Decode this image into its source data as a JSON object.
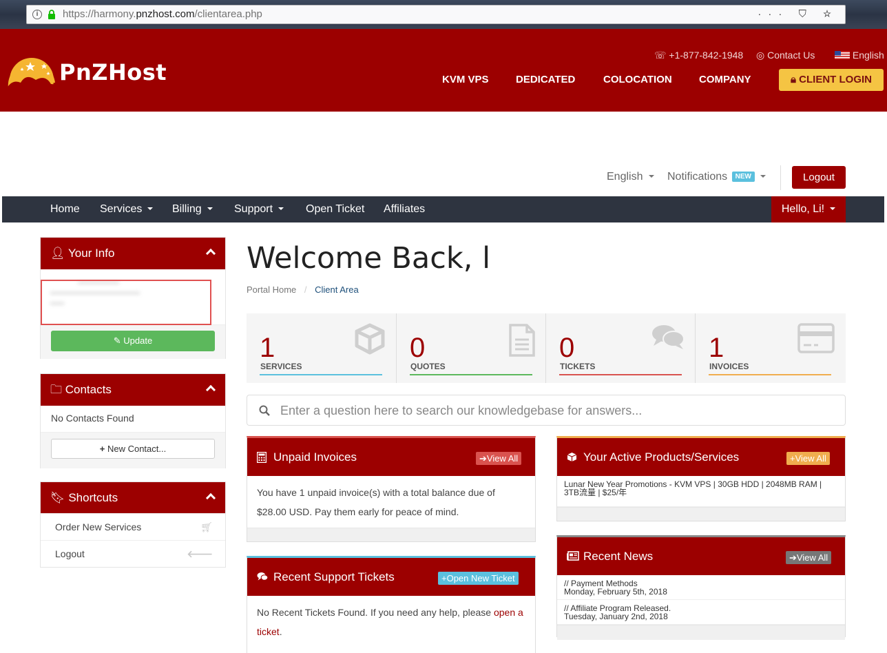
{
  "browser": {
    "url_prefix": "https://harmony.",
    "url_domain": "pnzhost.com",
    "url_path": "/clientarea.php",
    "tools": "··· ⛉ ☆"
  },
  "header": {
    "logo": "PnZHost",
    "phone": "+1-877-842-1948",
    "contact": "Contact Us",
    "language": "English",
    "nav": [
      "KVM VPS",
      "DEDICATED",
      "COLOCATION",
      "COMPANY"
    ],
    "client_login": "CLIENT LOGIN"
  },
  "toolbar": {
    "language": "English",
    "notifications": "Notifications",
    "new_badge": "NEW",
    "logout": "Logout"
  },
  "navbar": {
    "items": [
      "Home",
      "Services",
      "Billing",
      "Support",
      "Open Ticket",
      "Affiliates"
    ],
    "hello": "Hello, Li!"
  },
  "sidebar": {
    "your_info": {
      "title": "Your Info",
      "update": "Update"
    },
    "contacts": {
      "title": "Contacts",
      "empty": "No Contacts Found",
      "new_contact": "New Contact..."
    },
    "shortcuts": {
      "title": "Shortcuts",
      "items": [
        "Order New Services",
        "Logout"
      ]
    }
  },
  "main": {
    "welcome": "Welcome Back, l",
    "breadcrumb": {
      "home": "Portal Home",
      "separator": "/",
      "current": "Client Area"
    },
    "tiles": [
      {
        "value": "1",
        "label": "SERVICES",
        "color": "#5bc0de"
      },
      {
        "value": "0",
        "label": "QUOTES",
        "color": "#5cb85c"
      },
      {
        "value": "0",
        "label": "TICKETS",
        "color": "#d9534f"
      },
      {
        "value": "1",
        "label": "INVOICES",
        "color": "#f0ad4e"
      }
    ],
    "search_placeholder": "Enter a question here to search our knowledgebase for answers...",
    "unpaid": {
      "title": "Unpaid Invoices",
      "button": "View All",
      "text": "You have 1 unpaid invoice(s) with a total balance due of $28.00 USD. Pay them early for peace of mind."
    },
    "tickets": {
      "title": "Recent Support Tickets",
      "button": "Open New Ticket",
      "text": "No Recent Tickets Found. If you need any help, please ",
      "link": "open a ticket",
      "end": "."
    },
    "products": {
      "title": "Your Active Products/Services",
      "button": "View All",
      "item_line1": "Lunar New Year Promotions - KVM VPS | 30GB HDD | 2048MB RAM |",
      "item_line2": "3TB流量 | $25/年"
    },
    "news": {
      "title": "Recent News",
      "button": "View All",
      "items": [
        {
          "title": "// Payment Methods",
          "date": "Monday, February 5th, 2018"
        },
        {
          "title": "// Affiliate Program Released.",
          "date": "Tuesday, January 2nd, 2018"
        }
      ]
    }
  }
}
